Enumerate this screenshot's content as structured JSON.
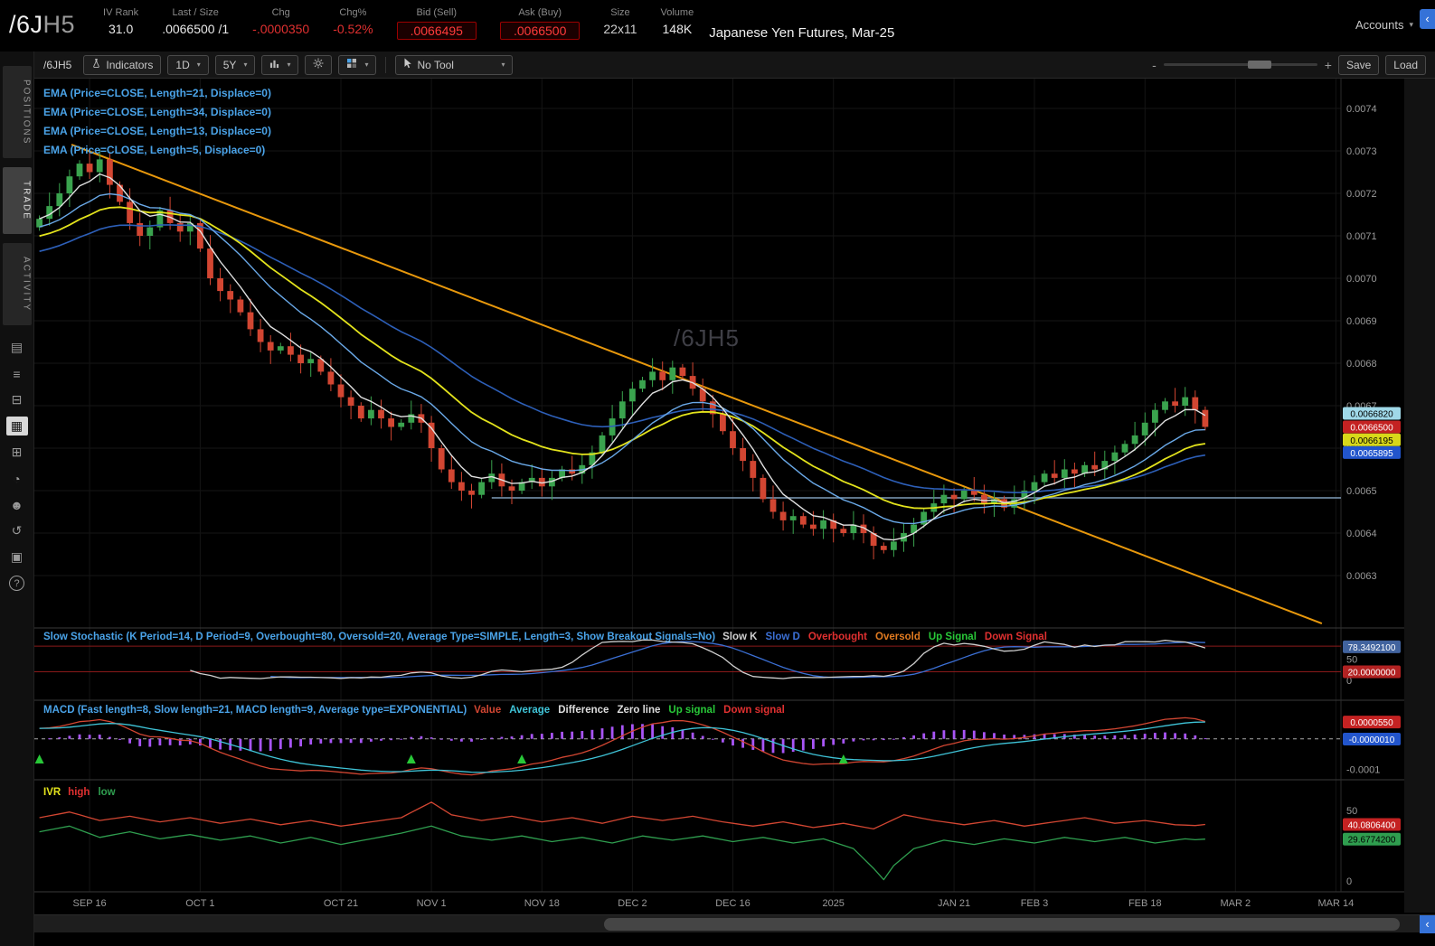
{
  "palette": {
    "up": "#3aa34e",
    "down": "#d24632",
    "ema5": "#e0e0e0",
    "ema13": "#6aa9e8",
    "ema21": "#e3e31c",
    "ema34": "#2d5fb8",
    "trendline": "#e8980c",
    "hline": "#7f9db9",
    "stoch_k": "#cfcfcf",
    "stoch_d": "#3b6fd4",
    "stoch_band": "#8b1a1a",
    "macd_value": "#d24632",
    "macd_avg": "#3fc4d8",
    "macd_hist": "#a855f7",
    "macd_zero": "#aaaaaa",
    "ivr_high": "#d24632",
    "ivr_low": "#2f9e4f",
    "accent_blue": "#4aa3e8",
    "neg_red": "#e03030",
    "signal_green": "#28c838"
  },
  "header": {
    "symbol": "/6J",
    "symbol_suffix": "H5",
    "fields": [
      {
        "label": "IV Rank",
        "value": "31.0",
        "style": "plain"
      },
      {
        "label": "Last / Size",
        "value": ".0066500 /1",
        "style": "plain"
      },
      {
        "label": "Chg",
        "value": "-.0000350",
        "style": "neg"
      },
      {
        "label": "Chg%",
        "value": "-0.52%",
        "style": "neg"
      },
      {
        "label": "Bid (Sell)",
        "value": ".0066495",
        "style": "box"
      },
      {
        "label": "Ask (Buy)",
        "value": ".0066500",
        "style": "box"
      },
      {
        "label": "Size",
        "value": "22x11",
        "style": "dim"
      },
      {
        "label": "Volume",
        "value": "148K",
        "style": "plain"
      }
    ],
    "description": "Japanese Yen Futures, Mar-25",
    "accounts_label": "Accounts",
    "collapse_glyph": "‹"
  },
  "sidebar": {
    "tabs": [
      {
        "label": "POSITIONS",
        "active": false
      },
      {
        "label": "TRADE",
        "active": true
      },
      {
        "label": "ACTIVITY",
        "active": false
      }
    ],
    "icons": [
      {
        "name": "reports-icon",
        "glyph": "▤",
        "active": false
      },
      {
        "name": "ledger-icon",
        "glyph": "≡",
        "active": false
      },
      {
        "name": "monitor-icon",
        "glyph": "⊟",
        "active": false
      },
      {
        "name": "charts-icon",
        "glyph": "▦",
        "active": true
      },
      {
        "name": "widgets-icon",
        "glyph": "⊞",
        "active": false
      },
      {
        "name": "clock-icon",
        "glyph": "◔",
        "active": false
      },
      {
        "name": "community-icon",
        "glyph": "☻",
        "active": false
      },
      {
        "name": "replay-icon",
        "glyph": "↺",
        "active": false
      },
      {
        "name": "snapshot-icon",
        "glyph": "▣",
        "active": false
      },
      {
        "name": "help-icon",
        "glyph": "?",
        "active": false
      }
    ]
  },
  "toolbar": {
    "symbol_label": "/6JH5",
    "indicators_label": "Indicators",
    "timeframe_value": "1D",
    "range_value": "5Y",
    "tool_value": "No Tool",
    "zoom_minus": "-",
    "zoom_plus": "+",
    "save_label": "Save",
    "load_label": "Load"
  },
  "chart_data": {
    "type": "candlestick",
    "watermark": "/6JH5",
    "slots": 130,
    "closes": [
      0.00714,
      0.00717,
      0.0072,
      0.00724,
      0.00727,
      0.00725,
      0.00728,
      0.00722,
      0.00718,
      0.00713,
      0.0071,
      0.00712,
      0.00716,
      0.00713,
      0.00711,
      0.00713,
      0.00707,
      0.007,
      0.00697,
      0.00695,
      0.00692,
      0.00688,
      0.00685,
      0.00683,
      0.00684,
      0.00682,
      0.0068,
      0.00681,
      0.00678,
      0.00675,
      0.00672,
      0.0067,
      0.00667,
      0.00669,
      0.00667,
      0.00665,
      0.00666,
      0.00668,
      0.00666,
      0.0066,
      0.00655,
      0.00652,
      0.0065,
      0.00649,
      0.00652,
      0.00654,
      0.00651,
      0.0065,
      0.00652,
      0.00653,
      0.00651,
      0.00653,
      0.00655,
      0.00654,
      0.00656,
      0.00659,
      0.00663,
      0.00667,
      0.00671,
      0.00674,
      0.00676,
      0.00678,
      0.00676,
      0.00679,
      0.00677,
      0.00674,
      0.00671,
      0.00668,
      0.00664,
      0.0066,
      0.00657,
      0.00653,
      0.00648,
      0.00645,
      0.00643,
      0.00644,
      0.00642,
      0.00641,
      0.00643,
      0.00641,
      0.0064,
      0.00642,
      0.0064,
      0.00637,
      0.00636,
      0.00638,
      0.0064,
      0.00642,
      0.00645,
      0.00647,
      0.00649,
      0.00648,
      0.0065,
      0.00649,
      0.00647,
      0.00648,
      0.00646,
      0.00648,
      0.0065,
      0.00652,
      0.00654,
      0.00653,
      0.00655,
      0.00654,
      0.00656,
      0.00655,
      0.00657,
      0.00659,
      0.00661,
      0.00663,
      0.00666,
      0.00669,
      0.00671,
      0.0067,
      0.00672,
      0.00669,
      0.00665
    ],
    "x_ticks": [
      {
        "label": "SEP 16",
        "idx": 5
      },
      {
        "label": "OCT 1",
        "idx": 16
      },
      {
        "label": "OCT 21",
        "idx": 30
      },
      {
        "label": "NOV 1",
        "idx": 39
      },
      {
        "label": "NOV 18",
        "idx": 50
      },
      {
        "label": "DEC 2",
        "idx": 59
      },
      {
        "label": "DEC 16",
        "idx": 69
      },
      {
        "label": "2025",
        "idx": 79
      },
      {
        "label": "JAN 21",
        "idx": 91
      },
      {
        "label": "FEB 3",
        "idx": 99
      },
      {
        "label": "FEB 18",
        "idx": 110
      },
      {
        "label": "MAR 2",
        "idx": 119
      },
      {
        "label": "MAR 14",
        "idx": 129
      }
    ],
    "y_ticks": [
      "0.0074",
      "0.0073",
      "0.0072",
      "0.0071",
      "0.0070",
      "0.0069",
      "0.0068",
      "0.0067",
      "0.0066",
      "0.0065",
      "0.0064",
      "0.0063"
    ],
    "ema_studies": [
      {
        "label": "EMA (Price=CLOSE, Length=21, Displace=0)",
        "length": 21,
        "label_color": "#4aa3e8"
      },
      {
        "label": "EMA (Price=CLOSE, Length=34, Displace=0)",
        "length": 34,
        "label_color": "#4aa3e8"
      },
      {
        "label": "EMA (Price=CLOSE, Length=13, Displace=0)",
        "length": 13,
        "label_color": "#4aa3e8"
      },
      {
        "label": "EMA (Price=CLOSE, Length=5, Displace=0)",
        "length": 5,
        "label_color": "#4aa3e8"
      }
    ],
    "bubbles": [
      {
        "text": "0.0066820",
        "value": 0.006682,
        "bg": "#9fd8e8",
        "fg": "#000"
      },
      {
        "text": "0.0066500",
        "value": 0.00665,
        "bg": "#c42222",
        "fg": "#fff"
      },
      {
        "text": "0.0066195",
        "value": 0.0066195,
        "bg": "#d8d81a",
        "fg": "#000"
      },
      {
        "text": "0.0065895",
        "value": 0.0065895,
        "bg": "#2255cc",
        "fg": "#fff"
      }
    ],
    "trend_line": {
      "from_idx": 3.2,
      "from_price": 0.007315,
      "to_idx": 127.6,
      "to_price": 0.006187
    },
    "h_line": {
      "price": 0.006483,
      "from_idx": 45
    },
    "stochastic": {
      "label": "Slow Stochastic (K Period=14, D Period=9, Overbought=80, Oversold=20, Average Type=SIMPLE, Length=3, Show Breakout Signals=No)",
      "label_color": "#4aa3e8",
      "legend": [
        {
          "text": "Slow K",
          "color": "#cfcfcf"
        },
        {
          "text": "Slow D",
          "color": "#3b6fd4"
        },
        {
          "text": "Overbought",
          "color": "#e03030"
        },
        {
          "text": "Oversold",
          "color": "#e07a20"
        },
        {
          "text": "Up Signal",
          "color": "#28c838"
        },
        {
          "text": "Down Signal",
          "color": "#e03030"
        }
      ],
      "k_period": 14,
      "d_period": 9,
      "overbought": 80,
      "oversold": 20,
      "smoothing": 3,
      "bubbles": [
        {
          "text": "78.3492100",
          "value": 78.34921,
          "bg": "#41639e",
          "fg": "#fff"
        },
        {
          "text": "20.0000000",
          "value": 20.0,
          "bg": "#b22222",
          "fg": "#fff"
        }
      ],
      "axis_labels": [
        {
          "text": "50",
          "value": 50
        },
        {
          "text": "0",
          "value": 0
        }
      ]
    },
    "macd": {
      "label": "MACD (Fast length=8, Slow length=21, MACD length=9, Average type=EXPONENTIAL)",
      "label_color": "#4aa3e8",
      "legend": [
        {
          "text": "Value",
          "color": "#d24632"
        },
        {
          "text": "Average",
          "color": "#3fc4d8"
        },
        {
          "text": "Difference",
          "color": "#dcdcdc"
        },
        {
          "text": "Zero line",
          "color": "#dcdcdc"
        },
        {
          "text": "Up signal",
          "color": "#28c838"
        },
        {
          "text": "Down signal",
          "color": "#e03030"
        }
      ],
      "fast": 8,
      "slow": 21,
      "signal": 9,
      "up_signal_idxs": [
        0,
        37,
        48,
        80
      ],
      "bubbles": [
        {
          "text": "0.0000550",
          "value": 5.5e-05,
          "bg": "#c42222",
          "fg": "#fff"
        },
        {
          "text": "-0.0000010",
          "value": -1e-06,
          "bg": "#2255cc",
          "fg": "#fff"
        }
      ],
      "axis_labels": [
        {
          "text": "-0.0001",
          "value": -0.0001
        }
      ]
    },
    "ivr": {
      "label": "IVR",
      "label_color": "#e3e31c",
      "legend": [
        {
          "text": "high",
          "color": "#e03030"
        },
        {
          "text": "low",
          "color": "#2f9e4f"
        }
      ],
      "high_points": {
        "idx": [
          0,
          3,
          6,
          9,
          12,
          15,
          18,
          21,
          24,
          27,
          30,
          33,
          36,
          39,
          41,
          44,
          47,
          50,
          53,
          56,
          59,
          62,
          65,
          68,
          71,
          74,
          77,
          80,
          83,
          86,
          89,
          92,
          95,
          98,
          101,
          104,
          107,
          110,
          113,
          116
        ],
        "v": [
          46,
          50,
          44,
          47,
          43,
          46,
          42,
          45,
          41,
          44,
          40,
          43,
          46,
          57,
          48,
          44,
          47,
          43,
          46,
          42,
          47,
          44,
          47,
          43,
          40,
          43,
          39,
          42,
          38,
          48,
          44,
          41,
          44,
          40,
          43,
          46,
          42,
          44,
          41,
          40.08064
        ]
      },
      "low_points": {
        "idx": [
          0,
          3,
          6,
          9,
          12,
          15,
          18,
          21,
          24,
          27,
          30,
          33,
          36,
          39,
          42,
          45,
          48,
          51,
          54,
          57,
          60,
          63,
          66,
          69,
          72,
          75,
          78,
          81,
          83,
          84,
          85,
          87,
          90,
          93,
          96,
          99,
          102,
          105,
          108,
          111,
          114,
          116
        ],
        "v": [
          36,
          40,
          32,
          36,
          31,
          34,
          30,
          33,
          28,
          32,
          27,
          31,
          35,
          40,
          33,
          30,
          33,
          29,
          32,
          28,
          33,
          30,
          33,
          29,
          32,
          28,
          31,
          24,
          10,
          2,
          12,
          24,
          30,
          27,
          31,
          28,
          32,
          29,
          32,
          28,
          31,
          29.67742
        ]
      },
      "bubbles": [
        {
          "text": "40.0806400",
          "value": 40.08064,
          "bg": "#c42222",
          "fg": "#fff"
        },
        {
          "text": "29.6774200",
          "value": 29.67742,
          "bg": "#2f9e4f",
          "fg": "#000"
        }
      ],
      "axis_labels": [
        {
          "text": "50",
          "value": 50
        },
        {
          "text": "0",
          "value": 0
        }
      ]
    }
  }
}
